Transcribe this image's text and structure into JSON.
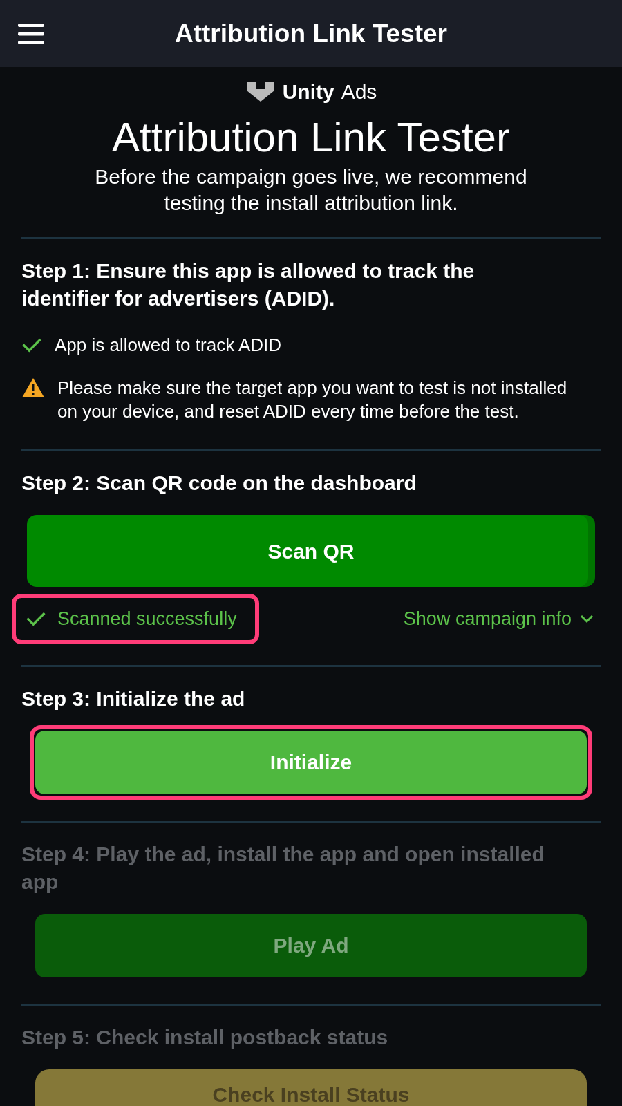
{
  "app_bar": {
    "title": "Attribution Link Tester"
  },
  "logo": {
    "brand": "Unity",
    "product": "Ads"
  },
  "heading": "Attribution Link Tester",
  "intro": "Before the campaign goes live, we recommend testing the install attribution link.",
  "steps": [
    {
      "title": "Step 1: Ensure this app is allowed to track the identifier for advertisers (ADID).",
      "disabled": false,
      "notes": [
        {
          "kind": "success",
          "text": "App is allowed to track ADID"
        },
        {
          "kind": "warning",
          "text": "Please make sure the target app you want to test is not installed on your device, and reset ADID every time before the test."
        }
      ]
    },
    {
      "title": "Step 2: Scan QR code on the dashboard",
      "disabled": false,
      "button": {
        "label": "Scan QR",
        "color": "#008a00",
        "highlighted": false
      },
      "status": {
        "text": "Scanned successfully",
        "highlighted": true
      },
      "link": {
        "text": "Show campaign info",
        "expanded": false
      }
    },
    {
      "title": "Step 3: Initialize the ad",
      "disabled": false,
      "button": {
        "label": "Initialize",
        "color": "#4fb83f",
        "highlighted": true
      }
    },
    {
      "title": "Step 4: Play the ad, install the app and open installed app",
      "disabled": true,
      "button": {
        "label": "Play Ad",
        "color": "#0a5c0a",
        "highlighted": false
      }
    },
    {
      "title": "Step 5: Check install postback status",
      "disabled": true,
      "button": {
        "label": "Check Install Status",
        "color": "#857838",
        "highlighted": false
      }
    }
  ]
}
